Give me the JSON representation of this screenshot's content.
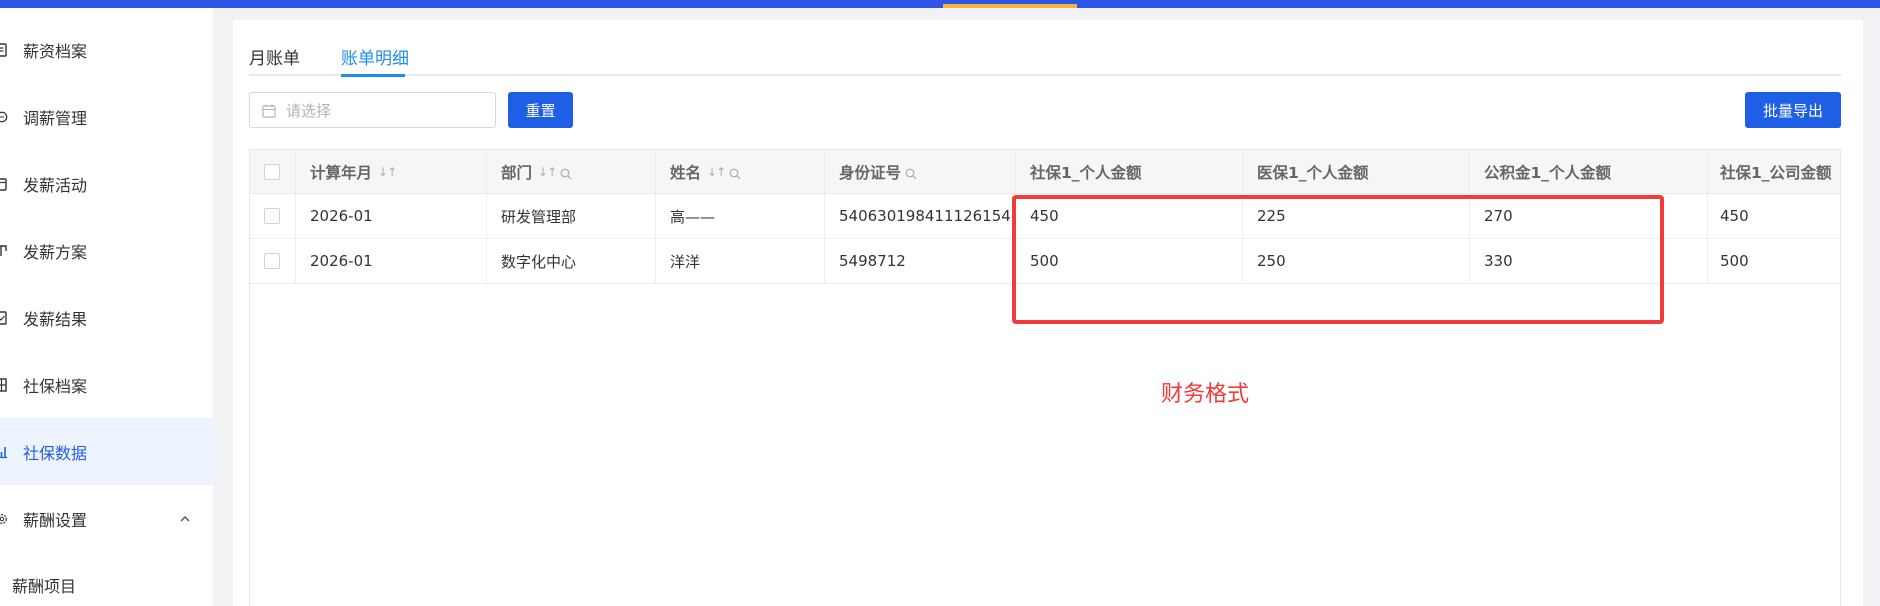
{
  "colors": {
    "brand": "#2d55e6",
    "primary": "#1f5fe6",
    "tab_active": "#1f8cf0",
    "annotation": "#f23a3a",
    "accent": "#f0b640"
  },
  "sidebar": {
    "items": [
      {
        "label": "薪资档案",
        "icon": "file-icon"
      },
      {
        "label": "调薪管理",
        "icon": "adjust-icon"
      },
      {
        "label": "发薪活动",
        "icon": "calendar-icon"
      },
      {
        "label": "发薪方案",
        "icon": "plan-icon"
      },
      {
        "label": "发薪结果",
        "icon": "result-icon"
      },
      {
        "label": "社保档案",
        "icon": "archive-icon"
      },
      {
        "label": "社保数据",
        "icon": "chart-icon"
      },
      {
        "label": "薪酬设置",
        "icon": "gear-icon"
      }
    ],
    "sub_items": [
      {
        "label": "薪酬项目"
      }
    ]
  },
  "tabs": [
    {
      "label": "月账单"
    },
    {
      "label": "账单明细"
    }
  ],
  "toolbar": {
    "date_placeholder": "请选择",
    "reset_label": "重置",
    "export_label": "批量导出"
  },
  "table": {
    "columns": [
      {
        "label": "计算年月",
        "sortable": true,
        "searchable": false
      },
      {
        "label": "部门",
        "sortable": true,
        "searchable": true
      },
      {
        "label": "姓名",
        "sortable": true,
        "searchable": true
      },
      {
        "label": "身份证号",
        "sortable": false,
        "searchable": true
      },
      {
        "label": "社保1_个人金额",
        "sortable": false,
        "searchable": false
      },
      {
        "label": "医保1_个人金额",
        "sortable": false,
        "searchable": false
      },
      {
        "label": "公积金1_个人金额",
        "sortable": false,
        "searchable": false
      },
      {
        "label": "社保1_公司金额",
        "sortable": false,
        "searchable": false
      }
    ],
    "rows": [
      [
        "2026-01",
        "研发管理部",
        "高——",
        "540630198411126154",
        "450",
        "225",
        "270",
        "450"
      ],
      [
        "2026-01",
        "数字化中心",
        "洋洋",
        "5498712",
        "500",
        "250",
        "330",
        "500"
      ]
    ]
  },
  "annotation": {
    "text": "财务格式"
  }
}
